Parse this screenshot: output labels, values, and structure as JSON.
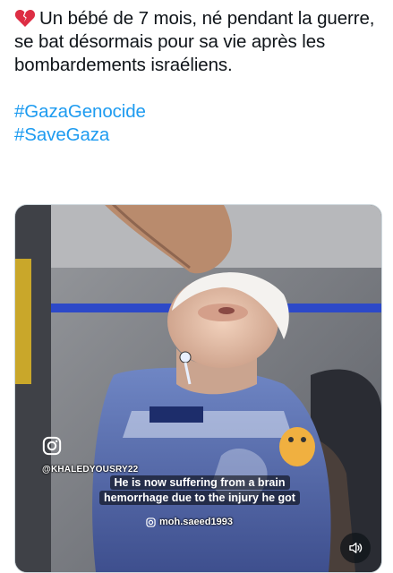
{
  "post": {
    "text": "Un bébé de 7 mois, né pendant la guerre, se bat désormais pour sa vie après les bombardements israéliens.",
    "emoji": "broken-heart",
    "hashtags": [
      "#GazaGenocide",
      "#SaveGaza"
    ]
  },
  "media": {
    "watermark_handle": "@KHALEDYOUSRY22",
    "caption": "He is now suffering from a brain hemorrhage due to the injury he got",
    "credit_handle": "moh.saeed1993",
    "icons": [
      "instagram-icon",
      "sound-icon"
    ],
    "colors": {
      "caption_bg": "#000000",
      "hashtag": "#1d9bf0"
    }
  }
}
